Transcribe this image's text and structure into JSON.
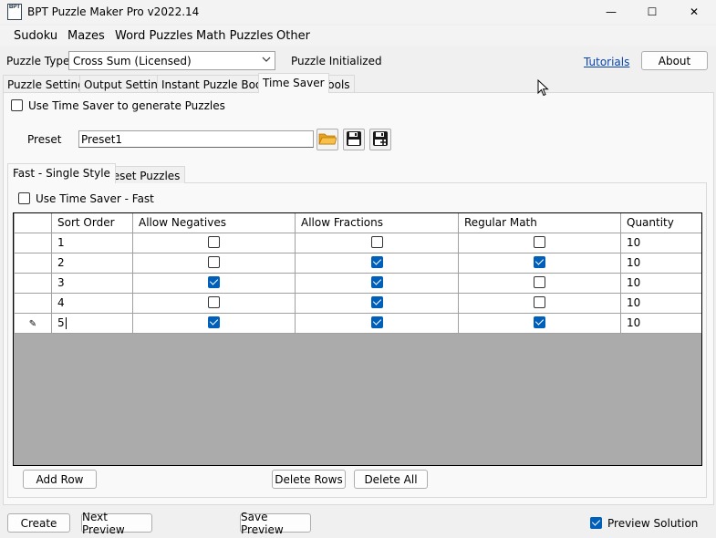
{
  "window": {
    "title": "BPT Puzzle Maker Pro v2022.14",
    "icon_text": "BPT",
    "minimize_glyph": "—",
    "maximize_glyph": "☐",
    "close_glyph": "✕"
  },
  "menu": [
    "Sudoku",
    "Mazes",
    "Word Puzzles",
    "Math Puzzles",
    "Other"
  ],
  "puzzle_type": {
    "label": "Puzzle Type",
    "value": "Cross Sum (Licensed)",
    "status": "Puzzle Initialized"
  },
  "links": {
    "tutorials": "Tutorials"
  },
  "buttons": {
    "about": "About",
    "add_row": "Add Row",
    "delete_rows": "Delete Rows",
    "delete_all": "Delete All",
    "create": "Create",
    "next_preview": "Next Preview",
    "save_preview": "Save Preview"
  },
  "tabs": [
    {
      "label": "Puzzle Settings",
      "active": false
    },
    {
      "label": "Output Settings",
      "active": false
    },
    {
      "label": "Instant Puzzle Books",
      "active": false
    },
    {
      "label": "Time Saver",
      "active": true
    },
    {
      "label": "Tools",
      "active": false
    }
  ],
  "time_saver": {
    "use_label": "Use Time Saver to generate Puzzles",
    "use_checked": false,
    "preset_label": "Preset",
    "preset_value": "Preset1"
  },
  "inner_tabs": [
    {
      "label": "Fast - Single Style",
      "active": true
    },
    {
      "label": "Preset Puzzles",
      "active": false
    }
  ],
  "fast": {
    "use_label": "Use Time Saver - Fast",
    "use_checked": false
  },
  "grid": {
    "columns": [
      "Sort Order",
      "Allow Negatives",
      "Allow Fractions",
      "Regular Math",
      "Quantity"
    ],
    "edit_glyph": "✎",
    "rows": [
      {
        "sort_order": "1",
        "allow_negatives": false,
        "allow_fractions": false,
        "regular_math": false,
        "quantity": "10"
      },
      {
        "sort_order": "2",
        "allow_negatives": false,
        "allow_fractions": true,
        "regular_math": true,
        "quantity": "10"
      },
      {
        "sort_order": "3",
        "allow_negatives": true,
        "allow_fractions": true,
        "regular_math": false,
        "quantity": "10"
      },
      {
        "sort_order": "4",
        "allow_negatives": false,
        "allow_fractions": true,
        "regular_math": false,
        "quantity": "10"
      },
      {
        "sort_order": "5",
        "allow_negatives": true,
        "allow_fractions": true,
        "regular_math": true,
        "quantity": "10",
        "editing": true
      }
    ]
  },
  "preview_solution": {
    "label": "Preview Solution",
    "checked": true
  },
  "colors": {
    "accent": "#005fb8",
    "grid_empty": "#ababab",
    "link": "#0645ad"
  }
}
